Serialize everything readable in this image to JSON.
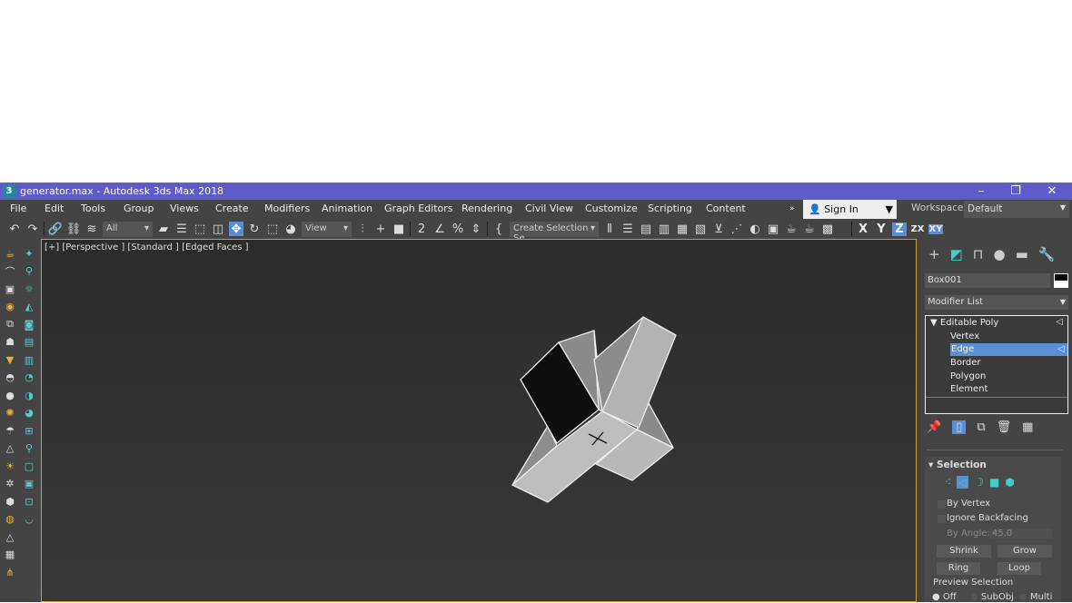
{
  "window": {
    "title": "generator.max - Autodesk 3ds Max 2018",
    "app_icon": "3",
    "controls": [
      "minimize-icon",
      "restore-icon",
      "close-icon"
    ]
  },
  "menu": [
    "File",
    "Edit",
    "Tools",
    "Group",
    "Views",
    "Create",
    "Modifiers",
    "Animation",
    "Graph Editors",
    "Rendering",
    "Civil View",
    "Customize",
    "Scripting",
    "Content"
  ],
  "account": {
    "sign_in": "Sign In",
    "workspaces_label": "Workspaces:",
    "workspace": "Default"
  },
  "toolbar": {
    "filter": "All",
    "coord": "View",
    "selection_set": "Create Selection Se",
    "axes": [
      "X",
      "Y",
      "Z",
      "ZX",
      "XY"
    ],
    "active_axis": "Z"
  },
  "viewport": {
    "label": "[+] [Perspective ] [Standard ] [Edged Faces ]"
  },
  "command_panel": {
    "object_name": "Box001",
    "object_color": "#000000",
    "modifier_list": "Modifier List",
    "stack": {
      "modifier": "Editable Poly",
      "subobjects": [
        "Vertex",
        "Edge",
        "Border",
        "Polygon",
        "Element"
      ],
      "selected": "Edge"
    },
    "rollout": {
      "title": "Selection",
      "by_vertex": "By Vertex",
      "ignore_backfacing": "Ignore Backfacing",
      "by_angle_label": "By Angle:",
      "by_angle_value": "45,0",
      "shrink": "Shrink",
      "grow": "Grow",
      "ring": "Ring",
      "loop": "Loop",
      "preview_label": "Preview Selection",
      "preview_options": [
        "Off",
        "SubObj",
        "Multi"
      ],
      "preview_selected": "Off"
    }
  },
  "colors": {
    "title_bar": "#5e5cc8",
    "accent": "#5b8fd4",
    "viewport_border": "#c9a236"
  }
}
